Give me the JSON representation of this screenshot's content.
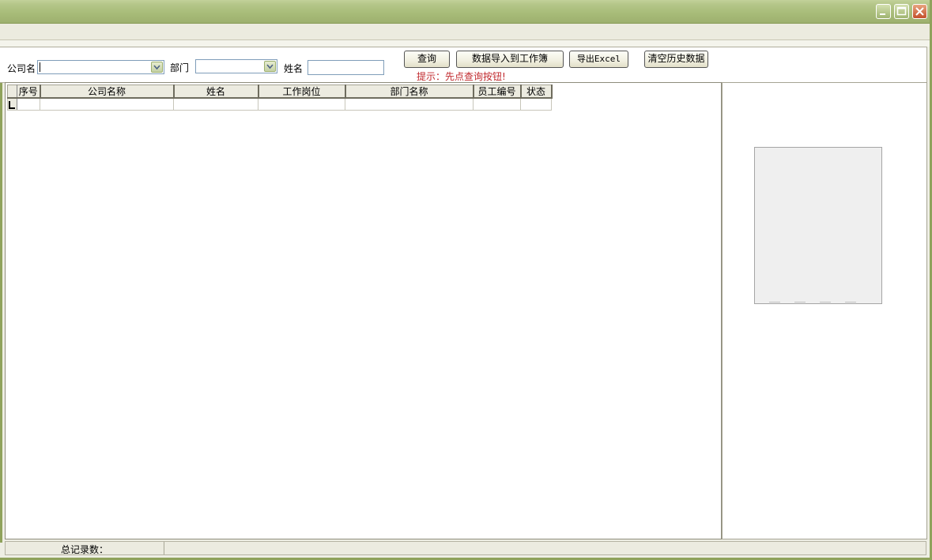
{
  "window_controls": {
    "minimize": "minimize-icon",
    "maximize": "maximize-icon",
    "close": "close-icon"
  },
  "filters": {
    "company_label": "公司名",
    "department_label": "部门",
    "name_label": "姓名",
    "company_value": "",
    "department_value": "",
    "name_value": ""
  },
  "buttons": {
    "query": "查询",
    "import_to_workbook": "数据导入到工作簿",
    "export_excel": "导出Excel",
    "clear_history": "清空历史数据"
  },
  "hint": "提示：先点查询按钮!",
  "grid": {
    "columns": [
      "序号",
      "公司名称",
      "姓名",
      "工作岗位",
      "部门名称",
      "员工编号",
      "状态"
    ]
  },
  "status": {
    "total_records_label": "总记录数："
  }
}
